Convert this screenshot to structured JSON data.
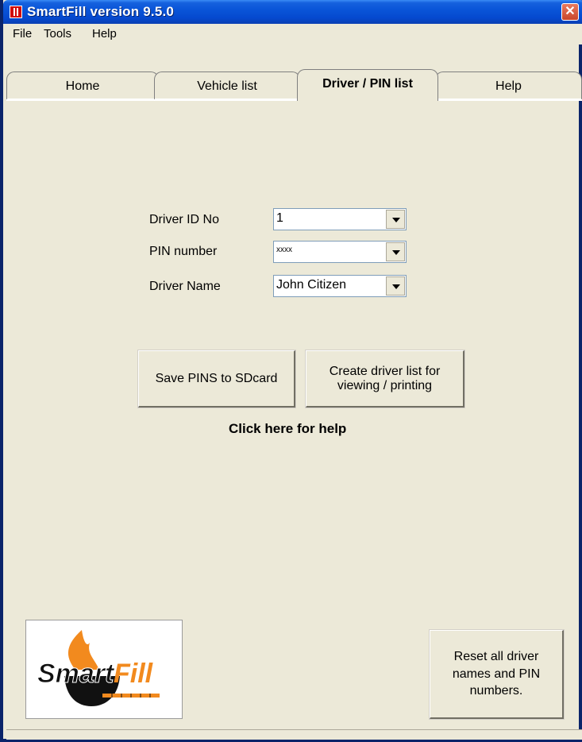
{
  "window": {
    "title": "SmartFill version 9.5.0"
  },
  "menu": {
    "items": [
      "File",
      "Tools",
      "Help"
    ]
  },
  "tabs": [
    {
      "label": "Home",
      "active": false
    },
    {
      "label": "Vehicle list",
      "active": false
    },
    {
      "label": "Driver / PIN list",
      "active": true
    },
    {
      "label": "Help",
      "active": false
    }
  ],
  "form": {
    "driver_id_label": "Driver ID No",
    "driver_id_value": "1",
    "pin_label": "PIN number",
    "pin_value": "xxxx",
    "driver_name_label": "Driver Name",
    "driver_name_value": "John Citizen"
  },
  "buttons": {
    "save_pins": "Save PINS to SDcard",
    "create_list_line1": "Create driver list for",
    "create_list_line2": "viewing / printing",
    "reset_line1": "Reset all driver",
    "reset_line2": "names and PIN",
    "reset_line3": "numbers."
  },
  "help_link": "Click here for help",
  "logo": {
    "text_black": "Smart",
    "text_orange": "Fill",
    "accent_color": "#f28a1e"
  },
  "colors": {
    "titlebar": "#0a55d8",
    "close": "#c9462a",
    "panel": "#ece9d8"
  }
}
